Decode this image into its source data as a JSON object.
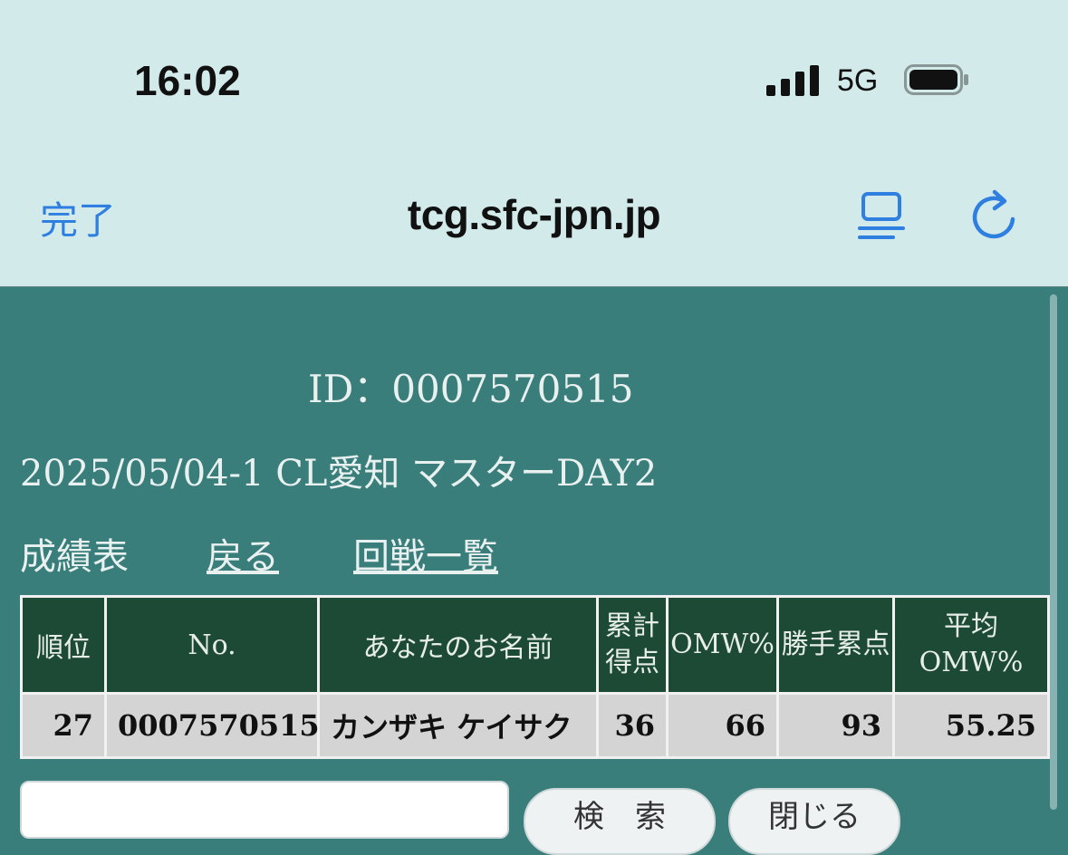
{
  "status": {
    "time": "16:02",
    "network": "5G"
  },
  "browser": {
    "done_label": "完了",
    "url": "tcg.sfc-jpn.jp",
    "accent_color": "#2f7fe0"
  },
  "page": {
    "id_line": "ID：0007570515",
    "event_title": "2025/05/04-1 CL愛知 マスターDAY2",
    "nav": {
      "title": "成績表",
      "back_link": "戻る",
      "rounds_link": "回戦一覧"
    },
    "table": {
      "headers": {
        "rank": "順位",
        "no": "No.",
        "name": "あなたのお名前",
        "points_line1": "累計",
        "points_line2": "得点",
        "omw": "OMW%",
        "cumulative": "勝手累点",
        "avg_omw": "平均OMW%"
      },
      "rows": [
        {
          "rank": "27",
          "no": "0007570515",
          "name": "カンザキ ケイサク",
          "points": "36",
          "omw": "66",
          "cumulative": "93",
          "avg_omw": "55.25"
        }
      ]
    },
    "buttons": {
      "search": "検　索",
      "close": "閉じる"
    }
  },
  "colors": {
    "page_bg": "#3a7e7b",
    "header_bg": "#1d4a34",
    "row_bg": "#d4d4d4",
    "rank_header": "#ffee44",
    "chrome_bg": "#d3eaeb"
  }
}
